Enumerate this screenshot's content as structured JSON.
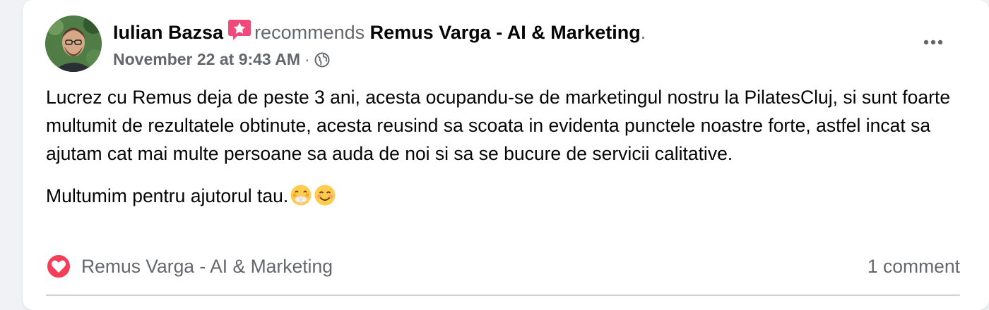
{
  "post": {
    "author": "Iulian Bazsa",
    "action": "recommends",
    "page": "Remus Varga - AI & Marketing",
    "period": ".",
    "timestamp": "November 22 at 9:43 AM",
    "separator": "·",
    "audience_icon": "globe-icon",
    "badge_icon": "recommend-star-icon",
    "more_icon": "more-options-icon",
    "paragraphs": [
      "Lucrez cu Remus deja de peste 3 ani, acesta ocupandu-se de marketingul nostru la PilatesCluj, si sunt foarte multumit de rezultatele obtinute, acesta reusind sa scoata in evidenta punctele noastre forte, astfel incat sa ajutam cat mai multe persoane sa auda de noi si sa se bucure de servicii calitative.",
      "Multumim pentru ajutorul tau."
    ],
    "emojis": [
      "face-with-open-eyes-and-hand-over-mouth-emoji",
      "smiling-face-emoji"
    ]
  },
  "footer": {
    "reaction_icon": "love-reaction-icon",
    "reaction_name": "Remus Varga - AI & Marketing",
    "comment_count": "1 comment"
  },
  "colors": {
    "background": "#f0f2f5",
    "card": "#ffffff",
    "primary_text": "#050505",
    "secondary_text": "#65676b",
    "badge": "#f0497a",
    "love": "#f33e58",
    "divider": "#ced0d4"
  }
}
